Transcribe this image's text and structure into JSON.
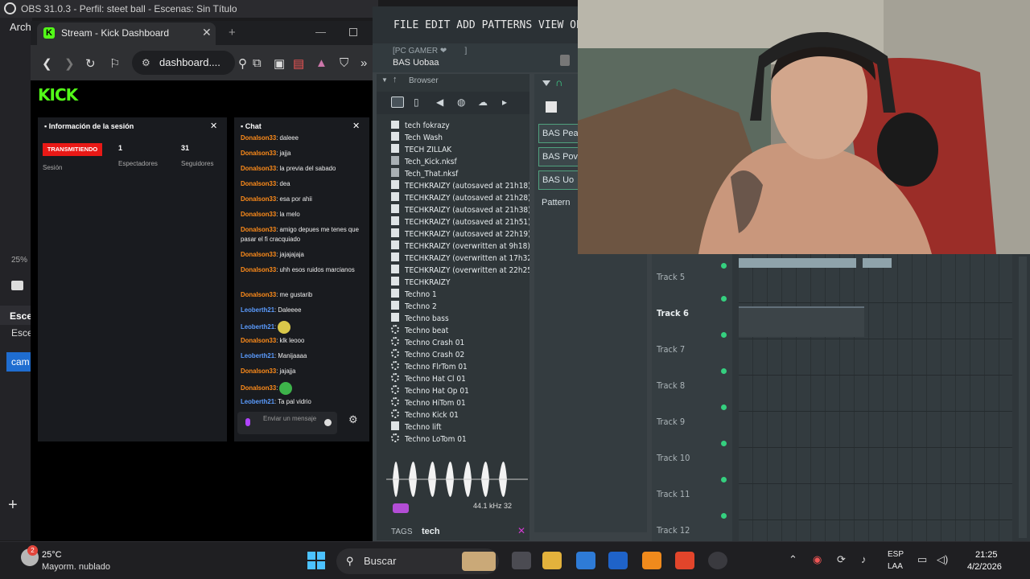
{
  "obs": {
    "title": "OBS 31.0.3 - Perfil: steet ball - Escenas: Sin Título",
    "menu_first": "Arch",
    "zoom": "25%",
    "scenes_header": "Esce",
    "scenes_item": "Esce",
    "scene_selected": "cam"
  },
  "browser": {
    "tab_title": "Stream - Kick Dashboard",
    "address": "dashboard...."
  },
  "kick": {
    "logo": "KICK",
    "session_panel": {
      "title": "Información de la sesión",
      "status": "TRANSMITIENDO",
      "session_label": "Sesión",
      "viewers": "1",
      "viewers_label": "Espectadores",
      "followers": "31",
      "followers_label": "Seguidores"
    },
    "chat_panel": {
      "title": "Chat",
      "input_placeholder": "Enviar un mensaje",
      "messages": [
        {
          "user": "Donalson33",
          "text": ": daleee"
        },
        {
          "user": "Donalson33",
          "text": ": jajja"
        },
        {
          "user": "Donalson33",
          "text": ": la previa del sabado"
        },
        {
          "user": "Donalson33",
          "text": ": dea"
        },
        {
          "user": "Donalson33",
          "text": ": esa por ahii"
        },
        {
          "user": "Donalson33",
          "text": ": la melo"
        },
        {
          "user": "Donalson33",
          "text": ": amigo depues me tenes que pasar el fi cracquiado"
        },
        {
          "user": "Donalson33",
          "text": ": jajajajaja"
        },
        {
          "user": "Donalson33",
          "text": ": uhh esos ruidos marcianos"
        },
        {
          "user": "Donalson33",
          "text": ": me gustarib"
        },
        {
          "user": "Leoberth21",
          "text": ": Daleeee"
        },
        {
          "user": "Leoberth21",
          "text": ":"
        },
        {
          "user": "Donalson33",
          "text": ": klk leooo"
        },
        {
          "user": "Leoberth21",
          "text": ": Manijaaaa"
        },
        {
          "user": "Donalson33",
          "text": ": jajajja"
        },
        {
          "user": "Donalson33",
          "text": ":"
        },
        {
          "user": "Leoberth21",
          "text": ": Ta pal vidrio"
        }
      ]
    }
  },
  "fl": {
    "menu": "FILE EDIT ADD PATTERNS VIEW OPTIONS TOOL",
    "hint_top": "[PC GAMER ❤",
    "hint_bracket": "]",
    "pattern_name": "BAS Uobaa",
    "browser_title": "Browser",
    "files": [
      {
        "name": "tech fokrazy",
        "icon": "file"
      },
      {
        "name": "Tech Wash",
        "icon": "file"
      },
      {
        "name": "TECH ZILLAK",
        "icon": "file"
      },
      {
        "name": "Tech_Kick.nksf",
        "icon": "ogg"
      },
      {
        "name": "Tech_That.nksf",
        "icon": "ogg"
      },
      {
        "name": "TECHKRAIZY (autosaved at 21h18)",
        "icon": "file"
      },
      {
        "name": "TECHKRAIZY (autosaved at 21h28)",
        "icon": "file"
      },
      {
        "name": "TECHKRAIZY (autosaved at 21h38)",
        "icon": "file"
      },
      {
        "name": "TECHKRAIZY (autosaved at 21h51)",
        "icon": "file"
      },
      {
        "name": "TECHKRAIZY (autosaved at 22h19)",
        "icon": "file"
      },
      {
        "name": "TECHKRAIZY (overwritten at 9h18)",
        "icon": "file"
      },
      {
        "name": "TECHKRAIZY (overwritten at 17h32)",
        "icon": "file"
      },
      {
        "name": "TECHKRAIZY (overwritten at 22h25)",
        "icon": "file"
      },
      {
        "name": "TECHKRAIZY",
        "icon": "file"
      },
      {
        "name": "Techno 1",
        "icon": "file"
      },
      {
        "name": "Techno 2",
        "icon": "file"
      },
      {
        "name": "Techno bass",
        "icon": "file"
      },
      {
        "name": "Techno beat",
        "icon": "gear"
      },
      {
        "name": "Techno Crash 01",
        "icon": "gear"
      },
      {
        "name": "Techno Crash 02",
        "icon": "gear"
      },
      {
        "name": "Techno FlrTom 01",
        "icon": "gear"
      },
      {
        "name": "Techno Hat Cl 01",
        "icon": "gear"
      },
      {
        "name": "Techno Hat Op 01",
        "icon": "gear"
      },
      {
        "name": "Techno HiTom 01",
        "icon": "gear"
      },
      {
        "name": "Techno Kick 01",
        "icon": "gear"
      },
      {
        "name": "Techno lift",
        "icon": "file"
      },
      {
        "name": "Techno LoTom 01",
        "icon": "gear"
      }
    ],
    "wav_info": "44.1 kHz 32",
    "tags_label": "TAGS",
    "tags_value": "tech",
    "rack_channels": [
      "BAS Pea",
      "BAS Pov",
      "BAS Uo",
      "Pattern"
    ],
    "tracks": [
      {
        "name": "Track 5",
        "active": false
      },
      {
        "name": "Track 6",
        "active": true
      },
      {
        "name": "Track 7",
        "active": false
      },
      {
        "name": "Track 8",
        "active": false
      },
      {
        "name": "Track 9",
        "active": false
      },
      {
        "name": "Track 10",
        "active": false
      },
      {
        "name": "Track 11",
        "active": false
      },
      {
        "name": "Track 12",
        "active": false
      }
    ]
  },
  "taskbar": {
    "weather_badge": "2",
    "temperature": "25°C",
    "weather_desc": "Mayorm. nublado",
    "search_placeholder": "Buscar",
    "lang_1": "ESP",
    "lang_2": "LAA",
    "time": "21:25",
    "date": "4/2/2026"
  },
  "colors": {
    "kick_green": "#53fc18",
    "live_red": "#e91916",
    "chat_user_orange": "#ff8c1a",
    "chat_user_blue": "#5b9cff",
    "fl_led_green": "#35d07f"
  }
}
